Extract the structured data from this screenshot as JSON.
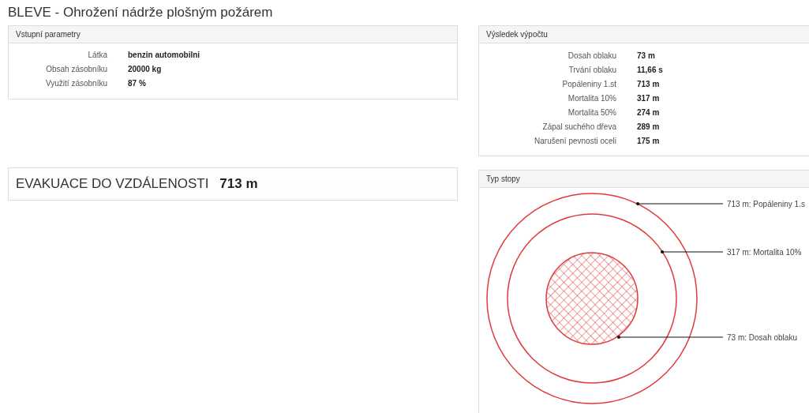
{
  "title": "BLEVE - Ohrožení nádrže plošným požárem",
  "inputs": {
    "heading": "Vstupní parametry",
    "rows": [
      {
        "label": "Látka",
        "value": "benzin automobilni"
      },
      {
        "label": "Obsah zásobníku",
        "value": "20000 kg"
      },
      {
        "label": "Využití zásobníku",
        "value": "87 %"
      }
    ]
  },
  "evacuation": {
    "label": "EVAKUACE DO VZDÁLENOSTI",
    "value": "713 m"
  },
  "results": {
    "heading": "Výsledek výpočtu",
    "rows": [
      {
        "label": "Dosah oblaku",
        "value": "73 m"
      },
      {
        "label": "Trvání oblaku",
        "value": "11,66 s"
      },
      {
        "label": "Popáleniny 1.st",
        "value": "713 m"
      },
      {
        "label": "Mortalita 10%",
        "value": "317 m"
      },
      {
        "label": "Mortalita 50%",
        "value": "274 m"
      },
      {
        "label": "Zápal suchého dřeva",
        "value": "289 m"
      },
      {
        "label": "Narušení pevnosti oceli",
        "value": "175 m"
      }
    ]
  },
  "footprint": {
    "heading": "Typ stopy",
    "zones": [
      {
        "kind": "ring",
        "label": "713 m: Popáleniny 1.s"
      },
      {
        "kind": "ring",
        "label": "317 m: Mortalita 10%"
      },
      {
        "kind": "hatched",
        "label": "73 m: Dosah oblaku"
      }
    ]
  }
}
